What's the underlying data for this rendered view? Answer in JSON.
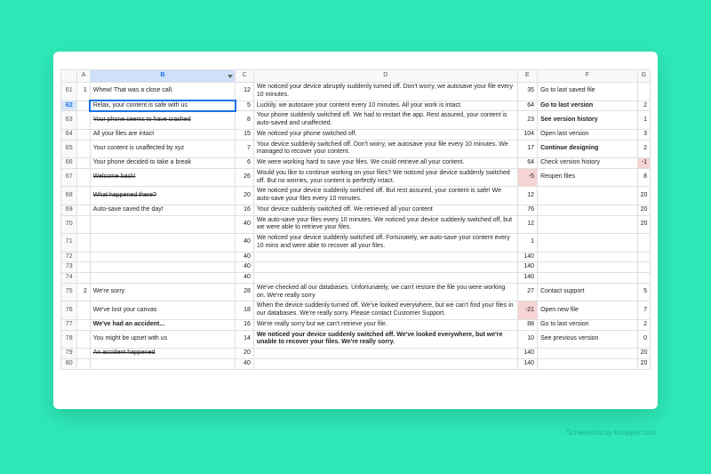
{
  "watermark": "Screenshot by Knapper.com",
  "columns": [
    "",
    "A",
    "B",
    "C",
    "D",
    "E",
    "F",
    "G"
  ],
  "selected_col": "B",
  "selected_row": "62",
  "rows": [
    {
      "n": "61",
      "A": "1",
      "B": "Whew! That was a close call.",
      "Bstyle": "",
      "C": "12",
      "D": "We noticed your device abruptly suddenly turned off. Don't worry, we autosave your file every 10 minutes.",
      "E": "35",
      "F": "Go to last saved file",
      "G": "",
      "tall": true
    },
    {
      "n": "62",
      "A": "",
      "B": "Relax, your content is safe with us",
      "Bstyle": "active",
      "C": "5",
      "D": "Luckily, we autosave your content every 10 minutes. All your work is intact.",
      "E": "64",
      "F": "Go to last version",
      "Fstyle": "bold",
      "G": "2"
    },
    {
      "n": "63",
      "A": "",
      "B": "Your phone seems to have crashed",
      "Bstyle": "strike",
      "C": "8",
      "D": "Your phone suddenly switched off. We had to restart the app. Rest assured, your content is auto-saved and unaffected.",
      "E": "23",
      "F": "See version history",
      "Fstyle": "bold",
      "G": "1",
      "tall": true
    },
    {
      "n": "64",
      "A": "",
      "B": "All your files are intact",
      "C": "15",
      "D": "We noticed your phone switched off.",
      "E": "104",
      "F": "Open last version",
      "G": "3"
    },
    {
      "n": "65",
      "A": "",
      "B": "Your content is unaffected by xyz",
      "C": "7",
      "D": "Your device suddenly switched off. Don't worry, we autosave your file every 10 minutes. We managed to recover your content.",
      "E": "17",
      "F": "Continue designing",
      "Fstyle": "bold",
      "G": "2",
      "tall": true
    },
    {
      "n": "66",
      "A": "",
      "B": "Your phone decided to take a break",
      "C": "6",
      "D": "We were working hard to save your files. We could retrieve all your content.",
      "E": "64",
      "F": "Check version history",
      "G": "-1",
      "Gstyle": "neg"
    },
    {
      "n": "67",
      "A": "",
      "B": "Welcome back!",
      "Bstyle": "strike",
      "C": "26",
      "D": "Would you like to continue working on your files? We noticed your device suddenly switched off. But no worries, your content is perfectly intact.",
      "E": "-5",
      "Estyle": "neg",
      "F": "Reopen files",
      "G": "8",
      "tall": true
    },
    {
      "n": "68",
      "A": "",
      "B": "What happened there?",
      "Bstyle": "strike",
      "C": "20",
      "D": "We noticed your device suddenly switched off. But rest assured, your content is safe! We auto-save your files every 10 minutes.",
      "E": "12",
      "F": "",
      "G": "20",
      "tall": true
    },
    {
      "n": "69",
      "A": "",
      "B": "Auto-save saved the day!",
      "C": "16",
      "D": "Your device suddenly switched off. We retrieved all your content",
      "E": "76",
      "F": "",
      "G": "20"
    },
    {
      "n": "70",
      "A": "",
      "B": "",
      "C": "40",
      "D": "We auto-save your files every 10 minutes. We noticed your device suddenly switched off, but we were able to retrieve your files.",
      "E": "12",
      "F": "",
      "G": "20",
      "tall": true
    },
    {
      "n": "71",
      "A": "",
      "B": "",
      "C": "40",
      "D": "We noticed your device suddenly switched off. Fortunately, we auto-save your content every 10 mins and were able to recover all your files.",
      "E": "1",
      "F": "",
      "G": "",
      "tall": true
    },
    {
      "n": "72",
      "A": "",
      "B": "",
      "C": "40",
      "D": "",
      "E": "140",
      "F": "",
      "G": ""
    },
    {
      "n": "73",
      "A": "",
      "B": "",
      "C": "40",
      "D": "",
      "E": "140",
      "F": "",
      "G": ""
    },
    {
      "n": "74",
      "A": "",
      "B": "",
      "C": "40",
      "D": "",
      "E": "140",
      "F": "",
      "G": ""
    },
    {
      "n": "75",
      "A": "2",
      "B": "We're sorry",
      "C": "28",
      "D": "We've checked all our databases. Unfortunately, we can't restore the file you were working on. We're really sorry",
      "E": "27",
      "F": "Contact support",
      "G": "5",
      "tall": true
    },
    {
      "n": "76",
      "A": "",
      "B": "We've lost your canvas",
      "C": "18",
      "D": "When the device suddenly turned off, We've looked everywhere, but we can't find your files in our databases. We're really sorry. Please contact Customer Support.",
      "E": "-21",
      "Estyle": "neg",
      "F": "Open new file",
      "G": "7",
      "tall": true
    },
    {
      "n": "77",
      "A": "",
      "B": "We've had an accident...",
      "Bstyle": "bold",
      "C": "16",
      "D": "We're really sorry but we can't retrieve your file.",
      "E": "88",
      "F": "Go to last version",
      "G": "2"
    },
    {
      "n": "78",
      "A": "",
      "B": "You might be upset with us",
      "C": "14",
      "D": "We noticed your device suddenly switched off. We've looked everywhere, but we're unable to recover your files. We're really sorry.",
      "Dstyle": "bold",
      "E": "10",
      "F": "See previous version",
      "G": "0",
      "tall": true
    },
    {
      "n": "79",
      "A": "",
      "B": "An accident happened",
      "Bstyle": "strike",
      "C": "20",
      "D": "",
      "E": "140",
      "F": "",
      "G": "20"
    },
    {
      "n": "80",
      "A": "",
      "B": "",
      "C": "40",
      "D": "",
      "E": "140",
      "F": "",
      "G": "20"
    }
  ],
  "chart_data": {
    "type": "table",
    "title": "Spreadsheet (rows 61–80, columns A–G)",
    "columns": [
      "row",
      "A",
      "B",
      "C",
      "D",
      "E",
      "F",
      "G"
    ],
    "series": [
      {
        "name": "row",
        "values": [
          61,
          62,
          63,
          64,
          65,
          66,
          67,
          68,
          69,
          70,
          71,
          72,
          73,
          74,
          75,
          76,
          77,
          78,
          79,
          80
        ]
      },
      {
        "name": "A",
        "values": [
          1,
          null,
          null,
          null,
          null,
          null,
          null,
          null,
          null,
          null,
          null,
          null,
          null,
          null,
          2,
          null,
          null,
          null,
          null,
          null
        ]
      },
      {
        "name": "B",
        "values": [
          "Whew! That was a close call.",
          "Relax, your content is safe with us",
          "Your phone seems to have crashed",
          "All your files are intact",
          "Your content is unaffected by xyz",
          "Your phone decided to take a break",
          "Welcome back!",
          "What happened there?",
          "Auto-save saved the day!",
          "",
          "",
          "",
          "",
          "",
          "We're sorry",
          "We've lost your canvas",
          "We've had an accident...",
          "You might be upset with us",
          "An accident happened",
          ""
        ]
      },
      {
        "name": "C",
        "values": [
          12,
          5,
          8,
          15,
          7,
          6,
          26,
          20,
          16,
          40,
          40,
          40,
          40,
          40,
          28,
          18,
          16,
          14,
          20,
          40
        ]
      },
      {
        "name": "D",
        "values": [
          "We noticed your device abruptly suddenly turned off. Don't worry, we autosave your file every 10 minutes.",
          "Luckily, we autosave your content every 10 minutes. All your work is intact.",
          "Your phone suddenly switched off. We had to restart the app. Rest assured, your content is auto-saved and unaffected.",
          "We noticed your phone switched off.",
          "Your device suddenly switched off. Don't worry, we autosave your file every 10 minutes. We managed to recover your content.",
          "We were working hard to save your files. We could retrieve all your content.",
          "Would you like to continue working on your files? We noticed your device suddenly switched off. But no worries, your content is perfectly intact.",
          "We noticed your device suddenly switched off. But rest assured, your content is safe! We auto-save your files every 10 minutes.",
          "Your device suddenly switched off. We retrieved all your content",
          "We auto-save your files every 10 minutes. We noticed your device suddenly switched off, but we were able to retrieve your files.",
          "We noticed your device suddenly switched off. Fortunately, we auto-save your content every 10 mins and were able to recover all your files.",
          "",
          "",
          "",
          "We've checked all our databases. Unfortunately, we can't restore the file you were working on. We're really sorry",
          "When the device suddenly turned off, We've looked everywhere, but we can't find your files in our databases. We're really sorry. Please contact Customer Support.",
          "We're really sorry but we can't retrieve your file.",
          "We noticed your device suddenly switched off. We've looked everywhere, but we're unable to recover your files. We're really sorry.",
          "",
          ""
        ]
      },
      {
        "name": "E",
        "values": [
          35,
          64,
          23,
          104,
          17,
          64,
          -5,
          12,
          76,
          12,
          1,
          140,
          140,
          140,
          27,
          -21,
          88,
          10,
          140,
          140
        ]
      },
      {
        "name": "F",
        "values": [
          "Go to last saved file",
          "Go to last version",
          "See version history",
          "Open last version",
          "Continue designing",
          "Check version history",
          "Reopen files",
          "",
          "",
          "",
          "",
          "",
          "",
          "",
          "Contact support",
          "Open new file",
          "Go to last version",
          "See previous version",
          "",
          ""
        ]
      },
      {
        "name": "G",
        "values": [
          null,
          2,
          1,
          3,
          2,
          -1,
          8,
          20,
          20,
          20,
          null,
          null,
          null,
          null,
          5,
          7,
          2,
          0,
          20,
          20
        ]
      }
    ]
  }
}
